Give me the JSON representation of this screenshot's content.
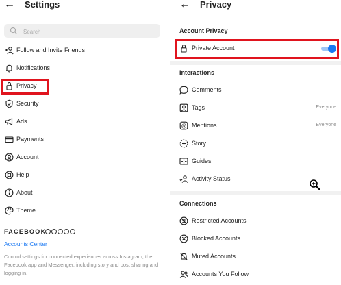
{
  "left_panel": {
    "title": "Settings",
    "search_placeholder": "Search",
    "menu": [
      {
        "label": "Follow and Invite Friends",
        "icon": "add-person-icon"
      },
      {
        "label": "Notifications",
        "icon": "bell-icon"
      },
      {
        "label": "Privacy",
        "icon": "lock-icon"
      },
      {
        "label": "Security",
        "icon": "shield-icon"
      },
      {
        "label": "Ads",
        "icon": "megaphone-icon"
      },
      {
        "label": "Payments",
        "icon": "credit-card-icon"
      },
      {
        "label": "Account",
        "icon": "account-circle-icon"
      },
      {
        "label": "Help",
        "icon": "lifebuoy-icon"
      },
      {
        "label": "About",
        "icon": "info-icon"
      },
      {
        "label": "Theme",
        "icon": "palette-icon"
      }
    ],
    "facebook": {
      "brand": "FACEBOOK",
      "accounts_center": "Accounts Center",
      "description": "Control settings for connected experiences across Instagram, the Facebook app and Messenger, including story and post sharing and logging in."
    }
  },
  "right_panel": {
    "title": "Privacy",
    "account_privacy": {
      "title": "Account Privacy",
      "private_account_label": "Private Account",
      "private_account_enabled": true
    },
    "interactions": {
      "title": "Interactions",
      "items": [
        {
          "label": "Comments",
          "value": "",
          "icon": "comment-icon"
        },
        {
          "label": "Tags",
          "value": "Everyone",
          "icon": "tag-person-icon"
        },
        {
          "label": "Mentions",
          "value": "Everyone",
          "icon": "mention-icon"
        },
        {
          "label": "Story",
          "value": "",
          "icon": "story-icon"
        },
        {
          "label": "Guides",
          "value": "",
          "icon": "guides-icon"
        },
        {
          "label": "Activity Status",
          "value": "",
          "icon": "activity-status-icon"
        }
      ]
    },
    "connections": {
      "title": "Connections",
      "items": [
        {
          "label": "Restricted Accounts",
          "icon": "restricted-icon"
        },
        {
          "label": "Blocked Accounts",
          "icon": "blocked-icon"
        },
        {
          "label": "Muted Accounts",
          "icon": "muted-bell-icon"
        },
        {
          "label": "Accounts You Follow",
          "icon": "following-icon"
        }
      ]
    }
  },
  "colors": {
    "highlight": "#e0141e",
    "accent": "#1877f2",
    "toggle_track": "#9ec6f6",
    "muted_text": "#8e8e8e"
  }
}
